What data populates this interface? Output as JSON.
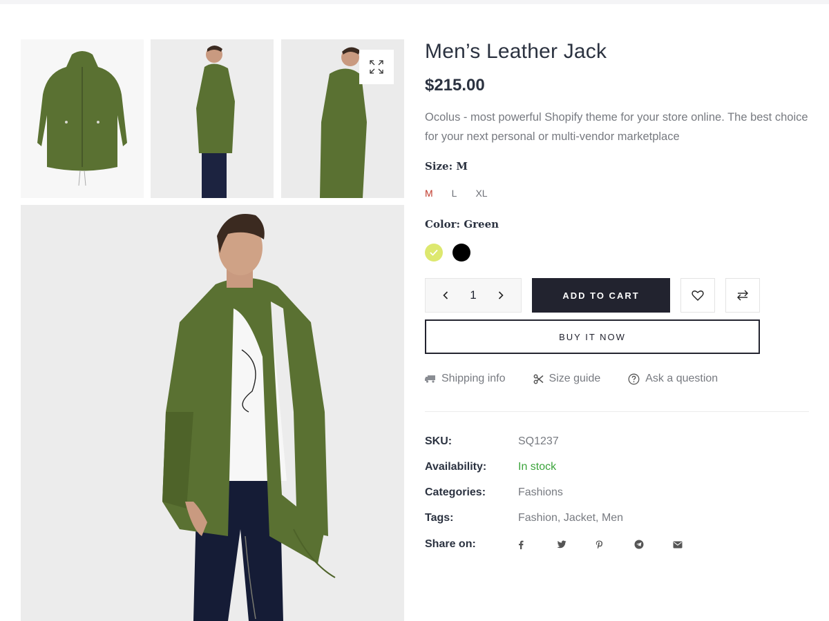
{
  "product": {
    "title": "Men’s Leather Jack",
    "price": "$215.00",
    "description": "Ocolus - most powerful Shopify theme for your store online. The best choice for your next personal or multi-vendor marketplace"
  },
  "size": {
    "label": "Size:",
    "selected": "M",
    "options": [
      "M",
      "L",
      "XL"
    ]
  },
  "color": {
    "label": "Color:",
    "selected": "Green",
    "swatches": [
      {
        "name": "green",
        "hex": "#dde86f",
        "selected": true
      },
      {
        "name": "black",
        "hex": "#000000",
        "selected": false
      }
    ]
  },
  "quantity": {
    "value": "1"
  },
  "actions": {
    "add_to_cart": "ADD TO CART",
    "buy_now": "BUY IT NOW"
  },
  "links": {
    "shipping": "Shipping info",
    "size_guide": "Size guide",
    "ask": "Ask a question"
  },
  "meta": {
    "sku_label": "SKU:",
    "sku": "SQ1237",
    "availability_label": "Availability:",
    "availability": "In stock",
    "categories_label": "Categories:",
    "categories": "Fashions",
    "tags_label": "Tags:",
    "tags": "Fashion, Jacket, Men",
    "share_label": "Share on:"
  },
  "share_icons": [
    "facebook-icon",
    "twitter-icon",
    "pinterest-icon",
    "telegram-icon",
    "email-icon"
  ],
  "colors": {
    "accent_red": "#c0392b",
    "dark": "#22232f",
    "stock_green": "#3aa33a",
    "jacket_green": "#5a7132"
  }
}
